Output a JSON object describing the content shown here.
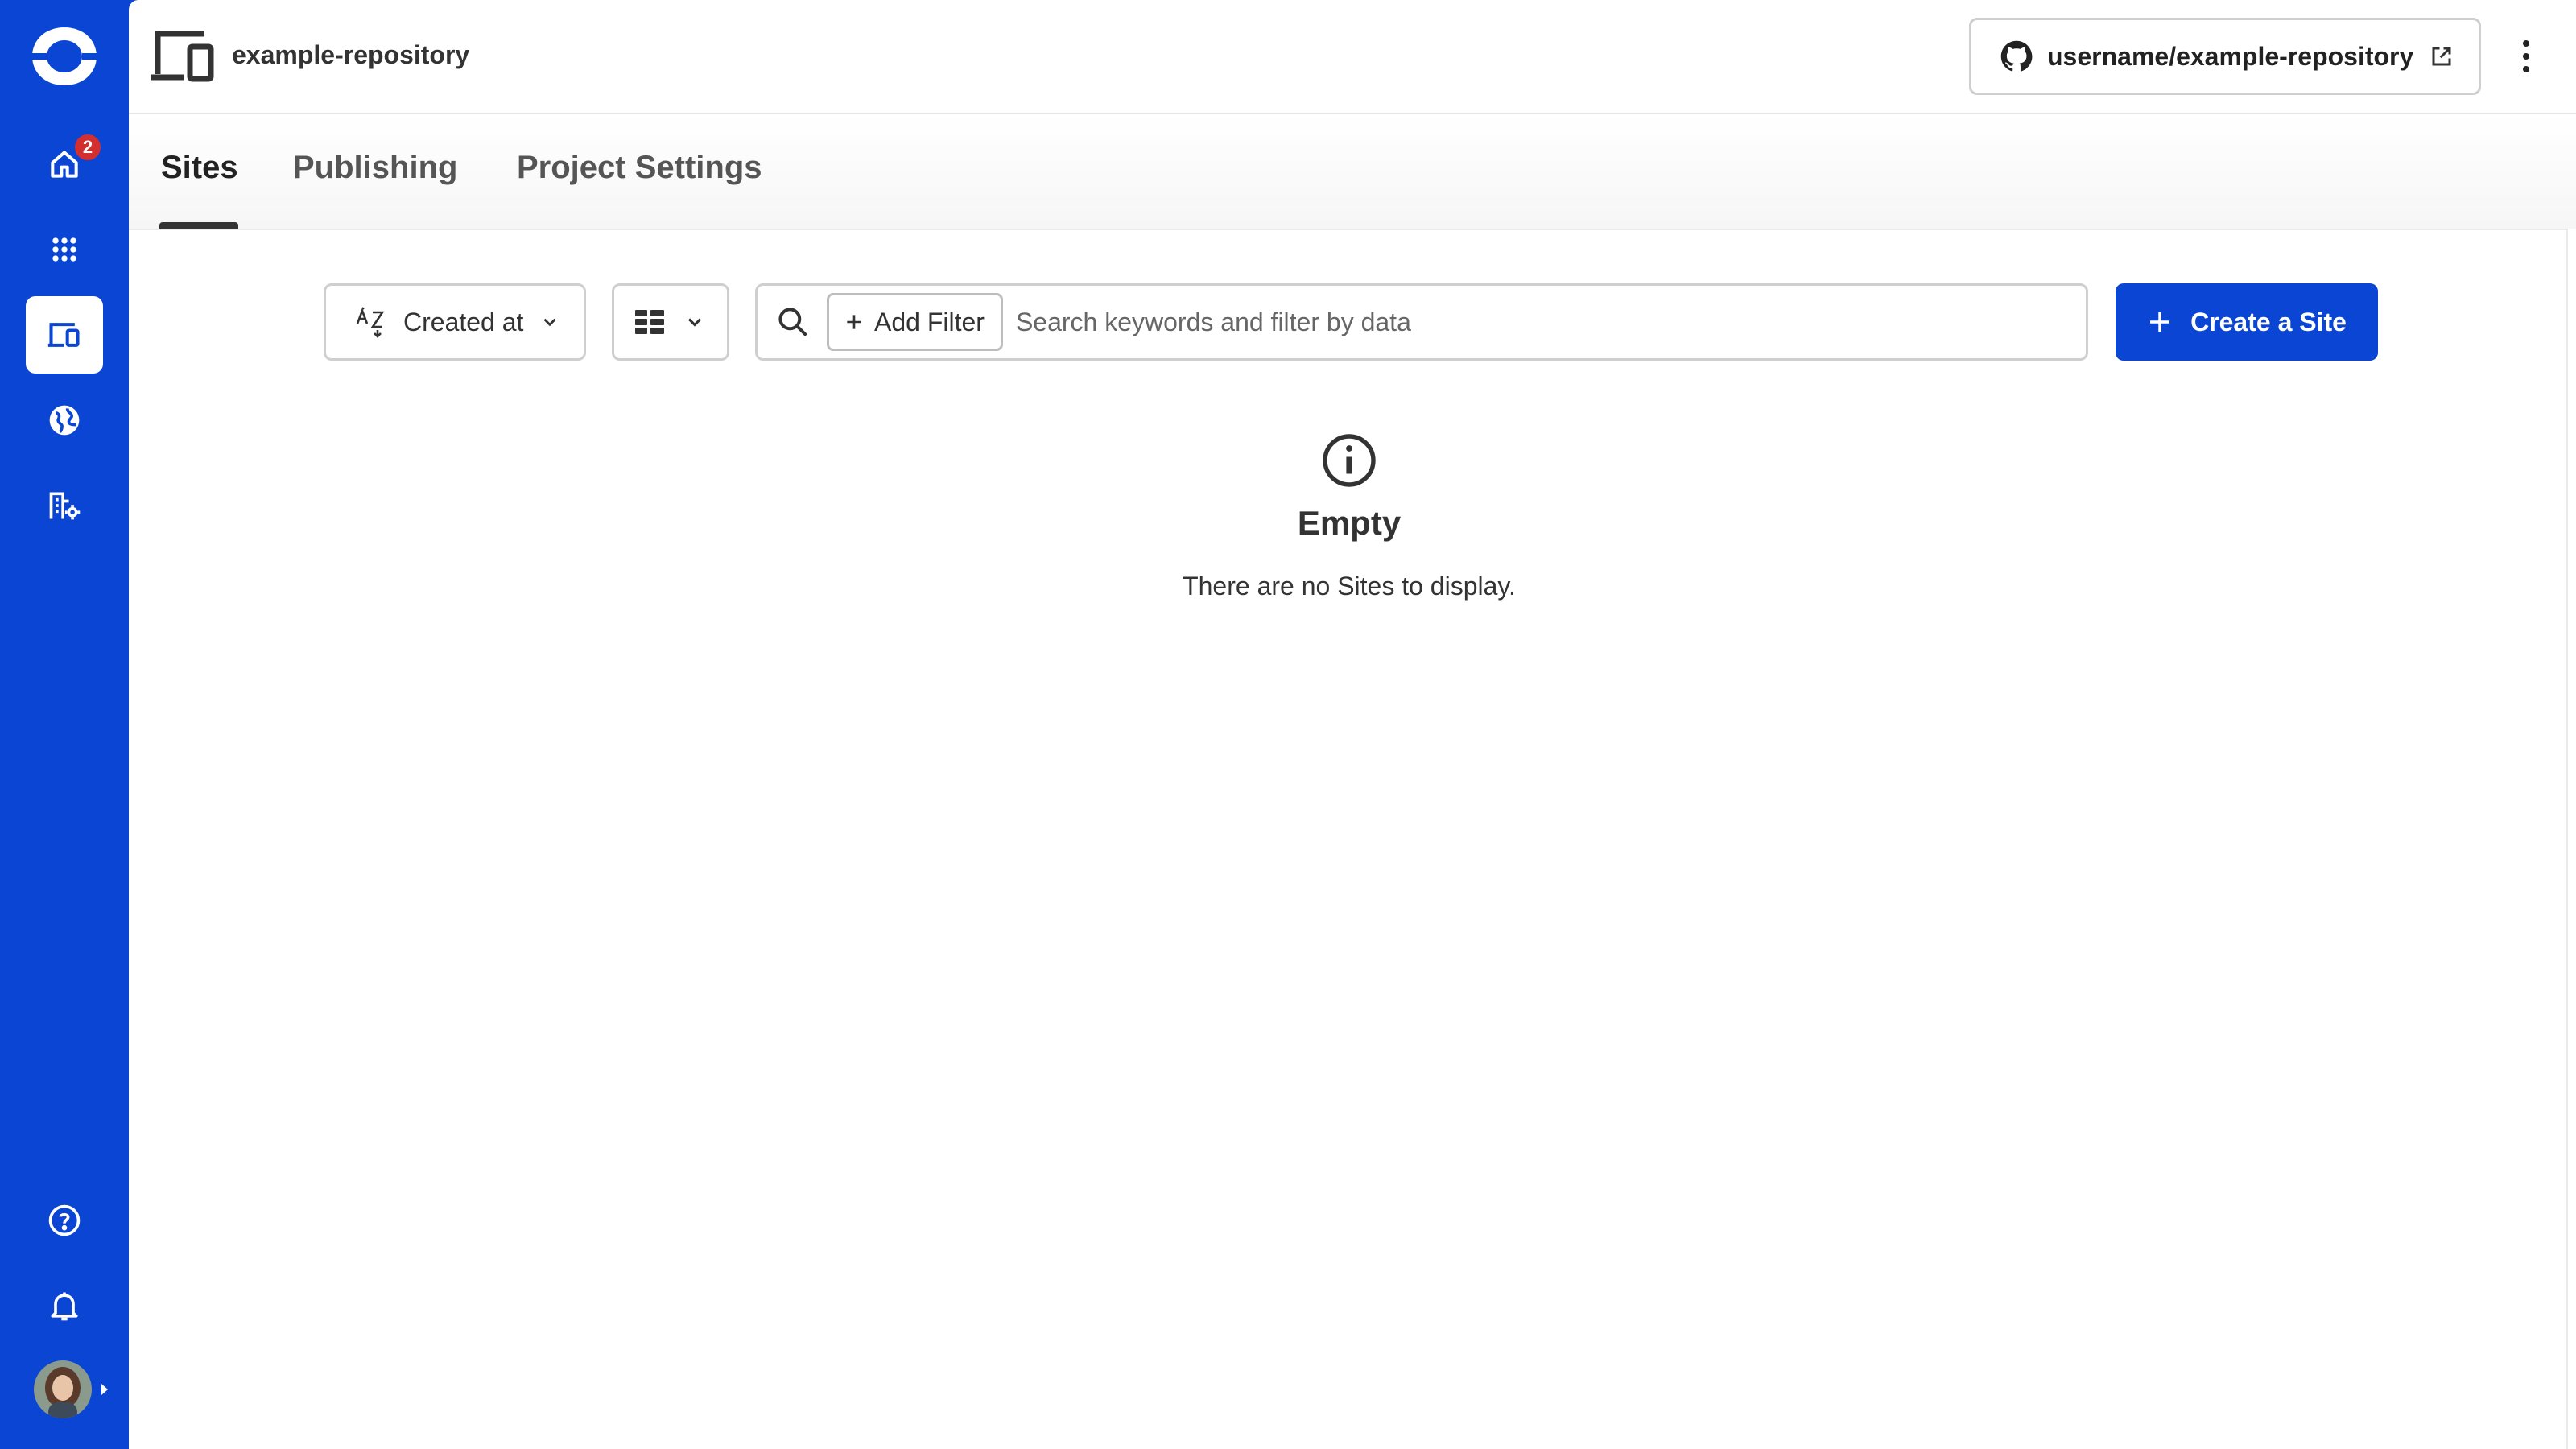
{
  "nav": {
    "home_badge": "2",
    "items": [
      {
        "icon": "home-icon"
      },
      {
        "icon": "apps-grid-icon"
      },
      {
        "icon": "devices-icon",
        "active": true
      },
      {
        "icon": "globe-icon"
      },
      {
        "icon": "organization-settings-icon"
      }
    ],
    "bottom_items": [
      {
        "icon": "help-icon"
      },
      {
        "icon": "bell-icon"
      }
    ]
  },
  "header": {
    "project_name": "example-repository",
    "repo_link_label": "username/example-repository"
  },
  "tabs": [
    {
      "label": "Sites",
      "active": true
    },
    {
      "label": "Publishing",
      "active": false
    },
    {
      "label": "Project Settings",
      "active": false
    }
  ],
  "toolbar": {
    "sort_label": "Created at",
    "add_filter_label": "Add Filter",
    "search_placeholder": "Search keywords and filter by data",
    "create_label": "Create a Site"
  },
  "empty_state": {
    "title": "Empty",
    "message": "There are no Sites to display."
  },
  "colors": {
    "brand": "#0b45d4",
    "badge": "#d32f2f"
  }
}
